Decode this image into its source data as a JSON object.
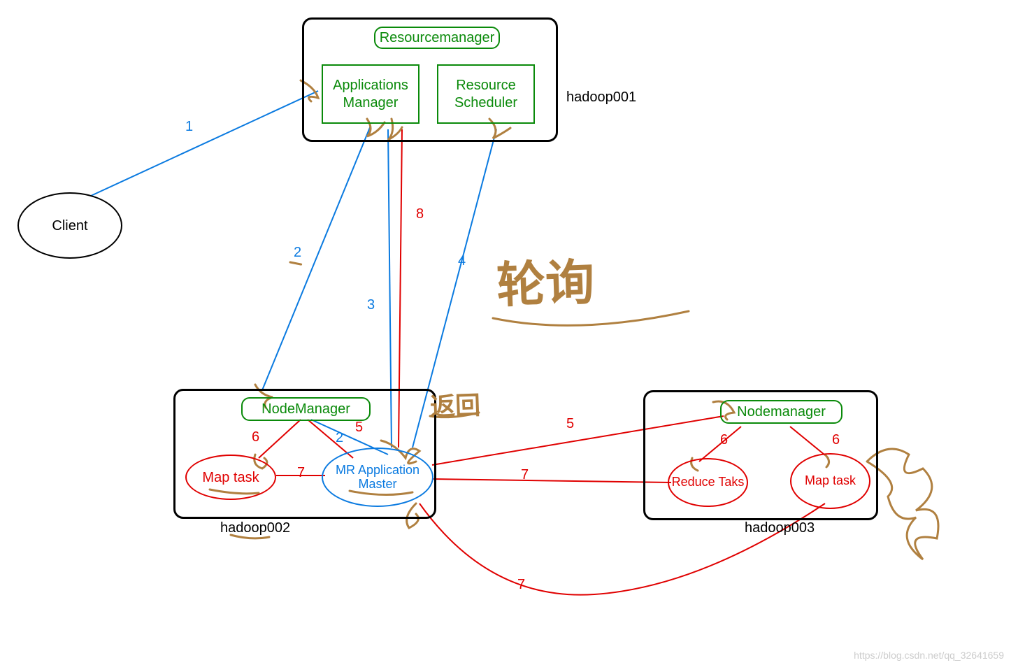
{
  "nodes": {
    "client": "Client",
    "resourcemanager": "Resourcemanager",
    "applications_manager": "Applications Manager",
    "resource_scheduler": "Resource Scheduler",
    "nodemanager_left": "NodeManager",
    "nodemanager_right": "Nodemanager",
    "mr_app_master": "MR Application Master",
    "map_task_left": "Map task",
    "reduce_task": "Reduce Taks",
    "map_task_right": "Map task"
  },
  "hosts": {
    "rm": "hadoop001",
    "nm_left": "hadoop002",
    "nm_right": "hadoop003"
  },
  "edges": {
    "e1": "1",
    "e2": "2",
    "e2b": "2",
    "e3": "3",
    "e4": "4",
    "e5_left": "5",
    "e5_right": "5",
    "e6_left": "6",
    "e6_r1": "6",
    "e6_r2": "6",
    "e7_left": "7",
    "e7_mid": "7",
    "e7_bottom": "7",
    "e8": "8"
  },
  "handwriting": {
    "note_right": "轮询",
    "note_mid": "返回"
  },
  "watermark": "https://blog.csdn.net/qq_32641659"
}
